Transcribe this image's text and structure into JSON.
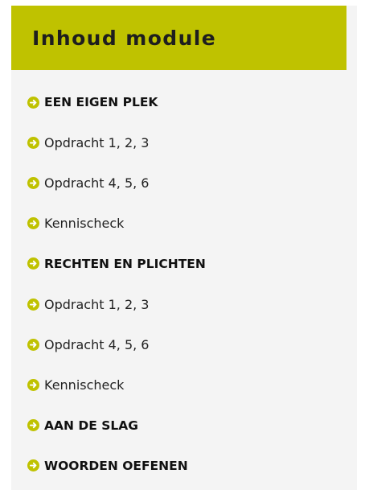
{
  "header": {
    "title": "Inhoud module"
  },
  "colors": {
    "header_background": "#bfc200",
    "panel_background": "#f4f4f4",
    "bullet_icon": "#bfc200",
    "text": "#222222"
  },
  "menu": {
    "items": [
      {
        "label": "EEN EIGEN PLEK",
        "kind": "section",
        "icon": "arrow-right-circle-icon"
      },
      {
        "label": "Opdracht 1, 2, 3",
        "kind": "item",
        "icon": "arrow-right-circle-icon"
      },
      {
        "label": "Opdracht 4, 5, 6",
        "kind": "item",
        "icon": "arrow-right-circle-icon"
      },
      {
        "label": "Kennischeck",
        "kind": "item",
        "icon": "arrow-right-circle-icon"
      },
      {
        "label": "RECHTEN EN PLICHTEN",
        "kind": "section",
        "icon": "arrow-right-circle-icon"
      },
      {
        "label": "Opdracht 1, 2, 3",
        "kind": "item",
        "icon": "arrow-right-circle-icon"
      },
      {
        "label": "Opdracht 4, 5, 6",
        "kind": "item",
        "icon": "arrow-right-circle-icon"
      },
      {
        "label": "Kennischeck",
        "kind": "item",
        "icon": "arrow-right-circle-icon"
      },
      {
        "label": "AAN DE SLAG",
        "kind": "section",
        "icon": "arrow-right-circle-icon"
      },
      {
        "label": "WOORDEN OEFENEN",
        "kind": "section",
        "icon": "arrow-right-circle-icon"
      }
    ]
  }
}
